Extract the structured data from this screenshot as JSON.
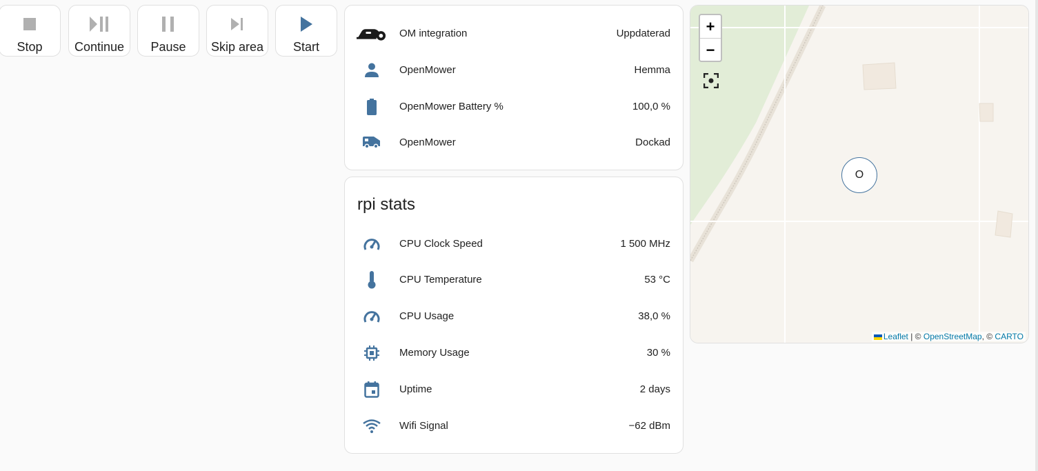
{
  "colors": {
    "icon": "#44739e",
    "icon_disabled": "#b0b0b0",
    "link": "#0078a8"
  },
  "buttons": [
    {
      "label": "Stop",
      "icon": "stop-icon",
      "enabled": false
    },
    {
      "label": "Continue",
      "icon": "play-pause-icon",
      "enabled": false
    },
    {
      "label": "Pause",
      "icon": "pause-icon",
      "enabled": false
    },
    {
      "label": "Skip area",
      "icon": "skip-next-icon",
      "enabled": false
    },
    {
      "label": "Start",
      "icon": "play-icon",
      "enabled": true
    }
  ],
  "status_card": {
    "rows": [
      {
        "icon": "robot-mower-icon",
        "name": "OM integration",
        "value": "Uppdaterad"
      },
      {
        "icon": "person-icon",
        "name": "OpenMower",
        "value": "Hemma"
      },
      {
        "icon": "battery-icon",
        "name": "OpenMower Battery %",
        "value": "100,0 %"
      },
      {
        "icon": "van-icon",
        "name": "OpenMower",
        "value": "Dockad"
      }
    ]
  },
  "rpi_card": {
    "title": "rpi stats",
    "rows": [
      {
        "icon": "speedometer-icon",
        "name": "CPU Clock Speed",
        "value": "1 500 MHz"
      },
      {
        "icon": "thermometer-icon",
        "name": "CPU Temperature",
        "value": "53 °C"
      },
      {
        "icon": "speedometer-icon",
        "name": "CPU Usage",
        "value": "38,0 %"
      },
      {
        "icon": "chip-icon",
        "name": "Memory Usage",
        "value": "30 %"
      },
      {
        "icon": "calendar-icon",
        "name": "Uptime",
        "value": "2 days"
      },
      {
        "icon": "wifi-icon",
        "name": "Wifi Signal",
        "value": "−62 dBm"
      }
    ]
  },
  "map": {
    "zoom_in": "+",
    "zoom_out": "−",
    "marker_label": "O",
    "attribution": {
      "leaflet": "Leaflet",
      "sep1": " | © ",
      "osm": "OpenStreetMap",
      "sep2": ", © ",
      "carto": "CARTO"
    }
  }
}
